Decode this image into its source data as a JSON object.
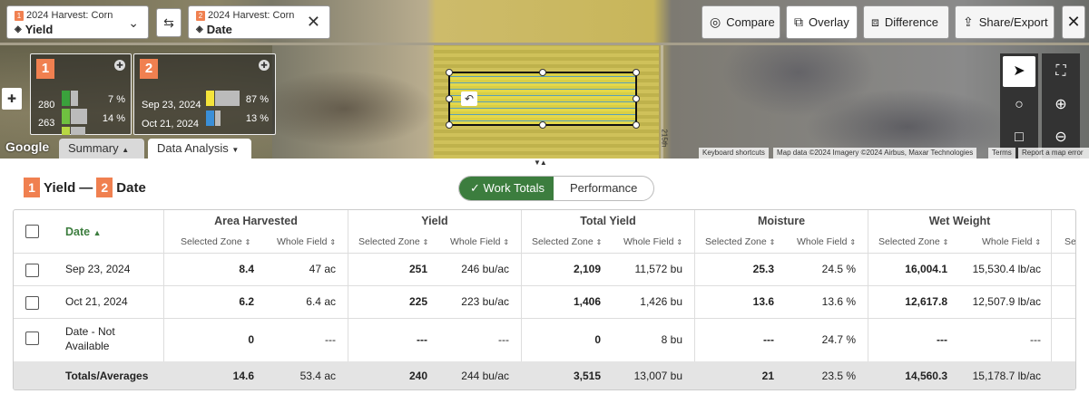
{
  "layer1": {
    "badge": "1",
    "title": "2024 Harvest: Corn",
    "layer": "Yield"
  },
  "layer2": {
    "badge": "2",
    "title": "2024 Harvest: Corn",
    "layer": "Date"
  },
  "toolbar": {
    "compare": "Compare",
    "overlay": "Overlay",
    "difference": "Difference",
    "share": "Share/Export"
  },
  "legend1": {
    "badge": "1",
    "rows": [
      {
        "value": "280",
        "pct": "7 %"
      },
      {
        "value": "263",
        "pct": "14 %"
      }
    ]
  },
  "legend2": {
    "badge": "2",
    "rows": [
      {
        "value": "Sep 23, 2024",
        "pct": "87 %"
      },
      {
        "value": "Oct 21, 2024",
        "pct": "13 %"
      }
    ]
  },
  "map": {
    "google": "Google",
    "road_label": "215th",
    "tabs": [
      "Summary",
      "Data Analysis"
    ],
    "attribution": {
      "shortcuts": "Keyboard shortcuts",
      "data": "Map data ©2024 Imagery ©2024 Airbus, Maxar Technologies",
      "terms": "Terms",
      "report": "Report a map error"
    }
  },
  "heading": {
    "b1": "1",
    "l1": "Yield",
    "sep": "—",
    "b2": "2",
    "l2": "Date"
  },
  "view_toggle": {
    "work_totals": "Work Totals",
    "performance": "Performance"
  },
  "table": {
    "date_header": "Date",
    "groups": [
      "Area Harvested",
      "Yield",
      "Total Yield",
      "Moisture",
      "Wet Weight"
    ],
    "sub_selected": "Selected Zone",
    "sub_whole": "Whole Field",
    "rows": [
      {
        "date": "Sep 23, 2024",
        "vals": [
          "8.4",
          "47 ac",
          "251",
          "246 bu/ac",
          "2,109",
          "11,572 bu",
          "25.3",
          "24.5 %",
          "16,004.1",
          "15,530.4 lb/ac"
        ]
      },
      {
        "date": "Oct 21, 2024",
        "vals": [
          "6.2",
          "6.4 ac",
          "225",
          "223 bu/ac",
          "1,406",
          "1,426 bu",
          "13.6",
          "13.6 %",
          "12,617.8",
          "12,507.9 lb/ac"
        ]
      },
      {
        "date": "Date - Not Available",
        "vals": [
          "0",
          "---",
          "---",
          "---",
          "0",
          "8 bu",
          "---",
          "24.7 %",
          "---",
          "---"
        ]
      }
    ],
    "totals": {
      "label": "Totals/Averages",
      "vals": [
        "14.6",
        "53.4 ac",
        "240",
        "244 bu/ac",
        "3,515",
        "13,007 bu",
        "21",
        "23.5 %",
        "14,560.3",
        "15,178.7 lb/ac"
      ]
    }
  }
}
